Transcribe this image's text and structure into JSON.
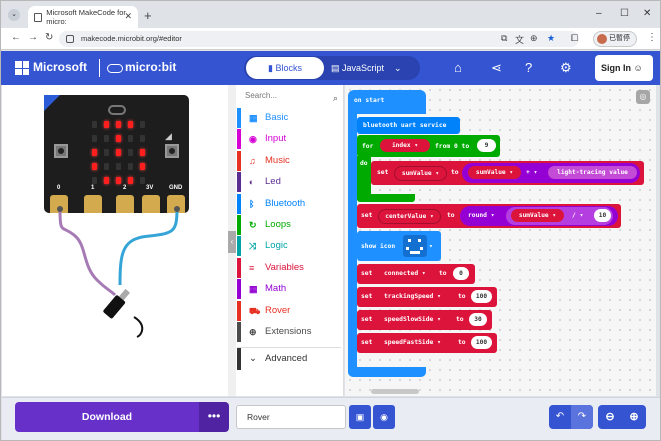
{
  "browser": {
    "tab_title": "Microsoft MakeCode for micro:",
    "url": "makecode.microbit.org/#editor",
    "profile_label": "已暫停"
  },
  "header": {
    "brand": "Microsoft",
    "product": "micro:bit",
    "blocks_label": "Blocks",
    "js_label": "JavaScript",
    "signin_label": "Sign In"
  },
  "simulator": {
    "pin_labels": [
      "0",
      "1",
      "2",
      "3V",
      "GND"
    ]
  },
  "toolbox": {
    "search_placeholder": "Search...",
    "categories": [
      {
        "label": "Basic",
        "color": "#1e90ff",
        "icon": "grid-icon"
      },
      {
        "label": "Input",
        "color": "#d400d4",
        "icon": "target-icon"
      },
      {
        "label": "Music",
        "color": "#e63022",
        "icon": "headphones-icon"
      },
      {
        "label": "Led",
        "color": "#5c2d91",
        "icon": "toggle-icon"
      },
      {
        "label": "Bluetooth",
        "color": "#0082fb",
        "icon": "bluetooth-icon"
      },
      {
        "label": "Loops",
        "color": "#00aa00",
        "icon": "refresh-icon"
      },
      {
        "label": "Logic",
        "color": "#00a4a6",
        "icon": "shuffle-icon"
      },
      {
        "label": "Variables",
        "color": "#dc143c",
        "icon": "list-icon"
      },
      {
        "label": "Math",
        "color": "#9400d3",
        "icon": "calculator-icon"
      },
      {
        "label": "Rover",
        "color": "#e63022",
        "icon": "car-icon"
      },
      {
        "label": "Extensions",
        "color": "#4b4b4b",
        "icon": "plus-circle-icon"
      }
    ],
    "advanced_label": "Advanced"
  },
  "workspace": {
    "on_start": "on start",
    "bt_uart": "bluetooth uart service",
    "for_label": "for",
    "for_var": "index",
    "for_from": "from 0 to",
    "for_to": "9",
    "do_label": "do",
    "set1_label": "set",
    "set1_var": "sumValue",
    "to_label": "to",
    "set1_operand": "sumValue",
    "op_plus": "+",
    "set1_value": "light-tracing value",
    "set2_label": "set",
    "set2_var": "centerValue",
    "round_label": "round",
    "set2_operand": "sumValue",
    "op_div": "/",
    "set2_divisor": "10",
    "show_icon": "show icon",
    "set3_label": "set",
    "set3_var": "connected",
    "set3_value": "0",
    "set4_label": "set",
    "set4_var": "trackingSpeed",
    "set4_value": "100",
    "set5_label": "set",
    "set5_var": "speedSlowSide",
    "set5_value": "30",
    "set6_label": "set",
    "set6_var": "speedFastSide",
    "set6_value": "100"
  },
  "footer": {
    "download_label": "Download",
    "more_label": "•••",
    "project_name": "Rover"
  }
}
